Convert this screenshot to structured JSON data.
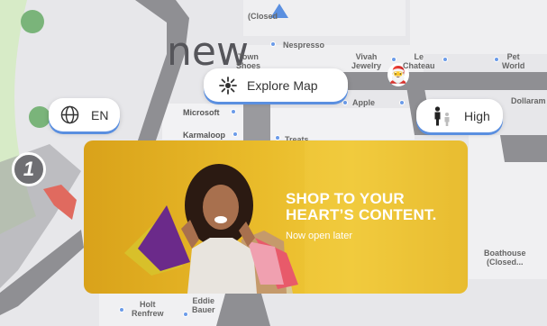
{
  "map": {
    "header_text": "new",
    "floor_number": "1",
    "stores": [
      {
        "id": "closed-top",
        "line1": "(Closed",
        "line2": ""
      },
      {
        "id": "nespresso",
        "line1": "Nespresso",
        "line2": ""
      },
      {
        "id": "town-shoes",
        "line1": "Town",
        "line2": "Shoes"
      },
      {
        "id": "vivah-jewelry",
        "line1": "Vivah",
        "line2": "Jewelry"
      },
      {
        "id": "le-chateau",
        "line1": "Le",
        "line2": "Chateau"
      },
      {
        "id": "pet-world",
        "line1": "Pet",
        "line2": "World"
      },
      {
        "id": "microsoft",
        "line1": "Microsoft",
        "line2": ""
      },
      {
        "id": "apple",
        "line1": "Apple",
        "line2": ""
      },
      {
        "id": "dollarama",
        "line1": "Dollarama",
        "line2": ""
      },
      {
        "id": "karmaloop",
        "line1": "Karmaloop",
        "line2": ""
      },
      {
        "id": "treats",
        "line1": "Treats",
        "line2": ""
      },
      {
        "id": "boathouse",
        "line1": "Boathouse",
        "line2": "(Closed..."
      },
      {
        "id": "holt-renfrew",
        "line1": "Holt",
        "line2": "Renfrew"
      },
      {
        "id": "eddie-bauer",
        "line1": "Eddie",
        "line2": "Bauer"
      }
    ]
  },
  "controls": {
    "explore_map_label": "Explore Map",
    "language_label": "EN",
    "crowd_level_label": "High"
  },
  "promo": {
    "title_line1": "SHOP TO YOUR",
    "title_line2": "HEART’S CONTENT.",
    "subtitle": "Now open later"
  },
  "colors": {
    "accent_blue": "#5a8fe0",
    "promo_yellow": "#e9bb2a",
    "map_path": "#9a9a9a"
  },
  "icons": {
    "explore": "sparkle-icon",
    "language": "globe-icon",
    "crowd": "people-icon",
    "santa": "santa-icon"
  }
}
